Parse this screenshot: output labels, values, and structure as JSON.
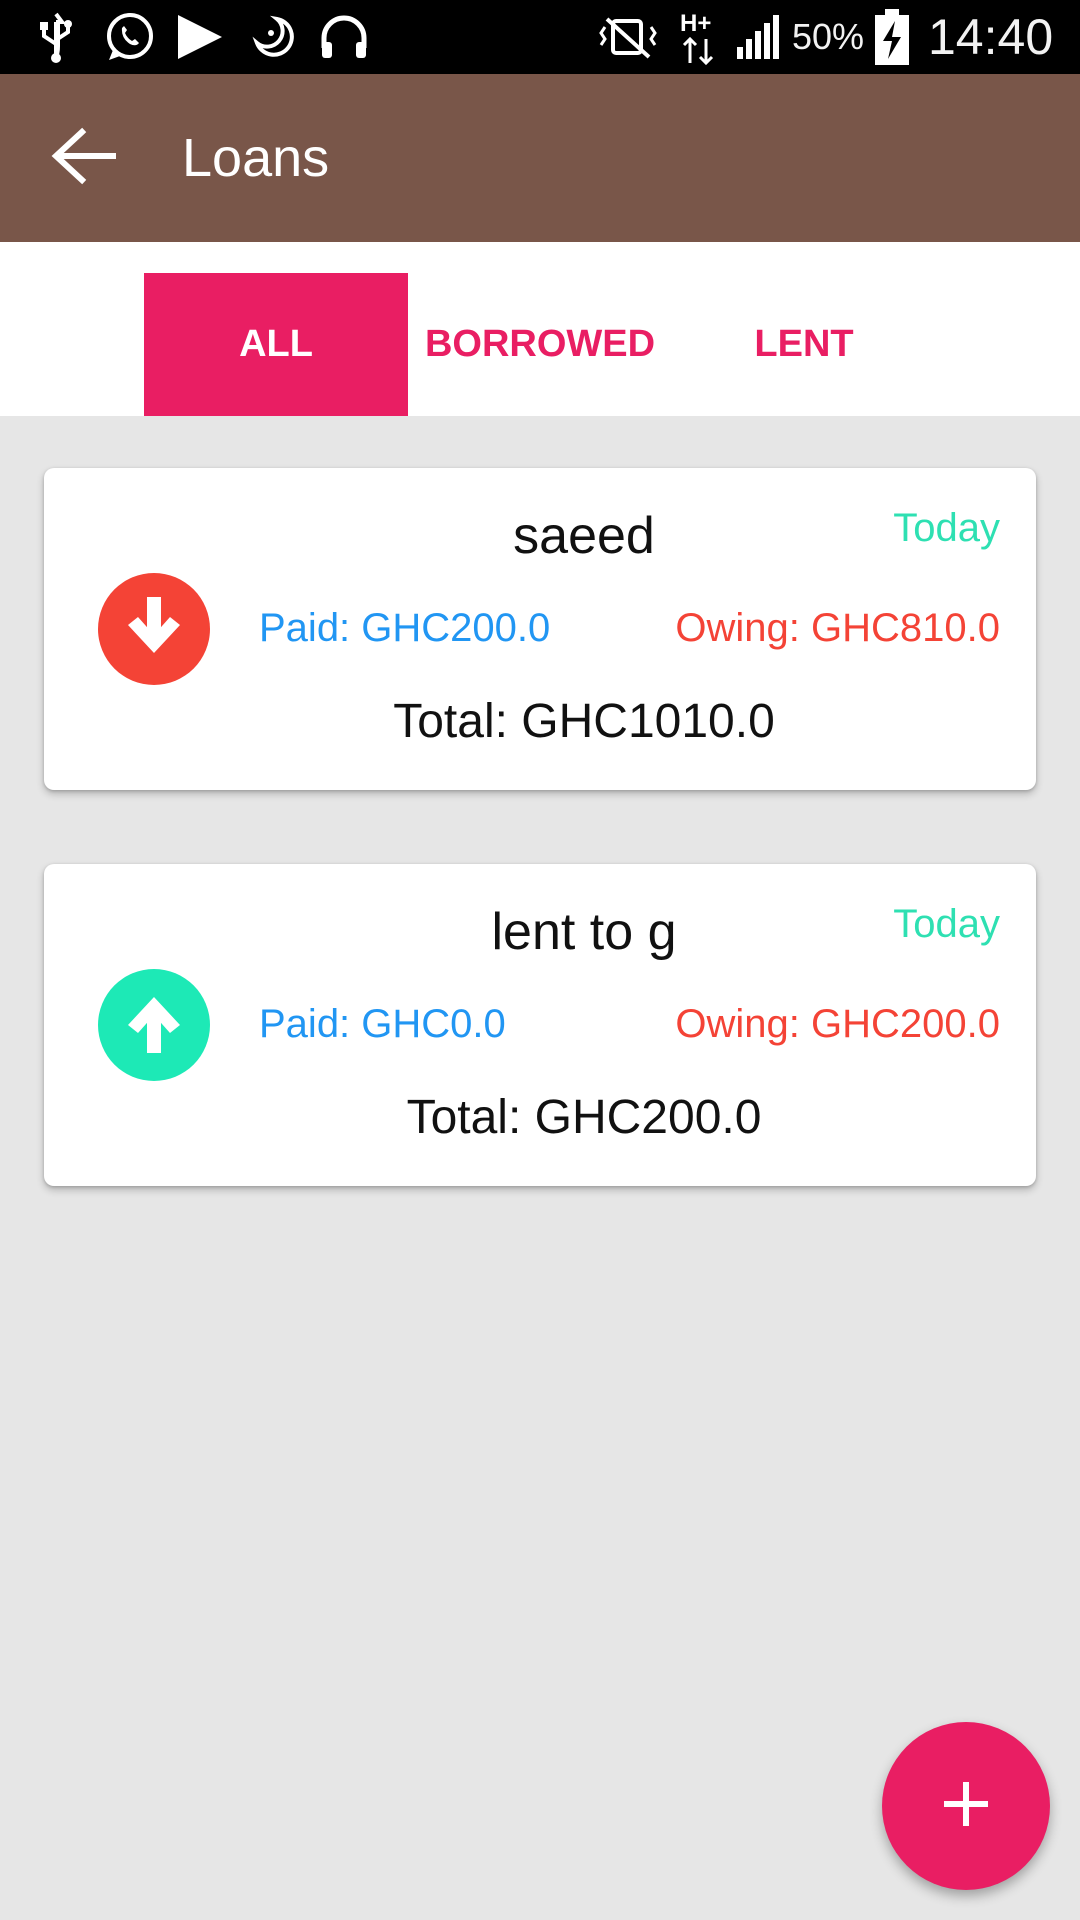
{
  "status_bar": {
    "battery": "50%",
    "time": "14:40",
    "network_type": "H+",
    "icons": [
      "usb-icon",
      "whatsapp-icon",
      "play-store-icon",
      "moon-icon",
      "headphones-icon",
      "vibrate-icon",
      "network-h-plus-icon",
      "signal-icon",
      "battery-charging-icon"
    ]
  },
  "app_bar": {
    "title": "Loans",
    "back_icon": "arrow-back-icon",
    "color": "#795649"
  },
  "tabs": [
    {
      "label": "ALL",
      "active": true
    },
    {
      "label": "BORROWED",
      "active": false
    },
    {
      "label": "LENT",
      "active": false
    }
  ],
  "colors": {
    "accent": "#e91e63",
    "paid": "#2196f3",
    "owing": "#f44336",
    "date": "#2ee0b2",
    "borrowed_icon": "#f44336",
    "lent_icon": "#1de9b6"
  },
  "loans": [
    {
      "name": "saeed",
      "date": "Today",
      "paid": "Paid: GHC200.0",
      "owing": "Owing: GHC810.0",
      "total": "Total: GHC1010.0",
      "direction": "borrowed",
      "icon": "arrow-down-icon"
    },
    {
      "name": "lent to g",
      "date": "Today",
      "paid": "Paid: GHC0.0",
      "owing": "Owing: GHC200.0",
      "total": "Total: GHC200.0",
      "direction": "lent",
      "icon": "arrow-up-icon"
    }
  ],
  "fab": {
    "icon": "plus-icon"
  }
}
